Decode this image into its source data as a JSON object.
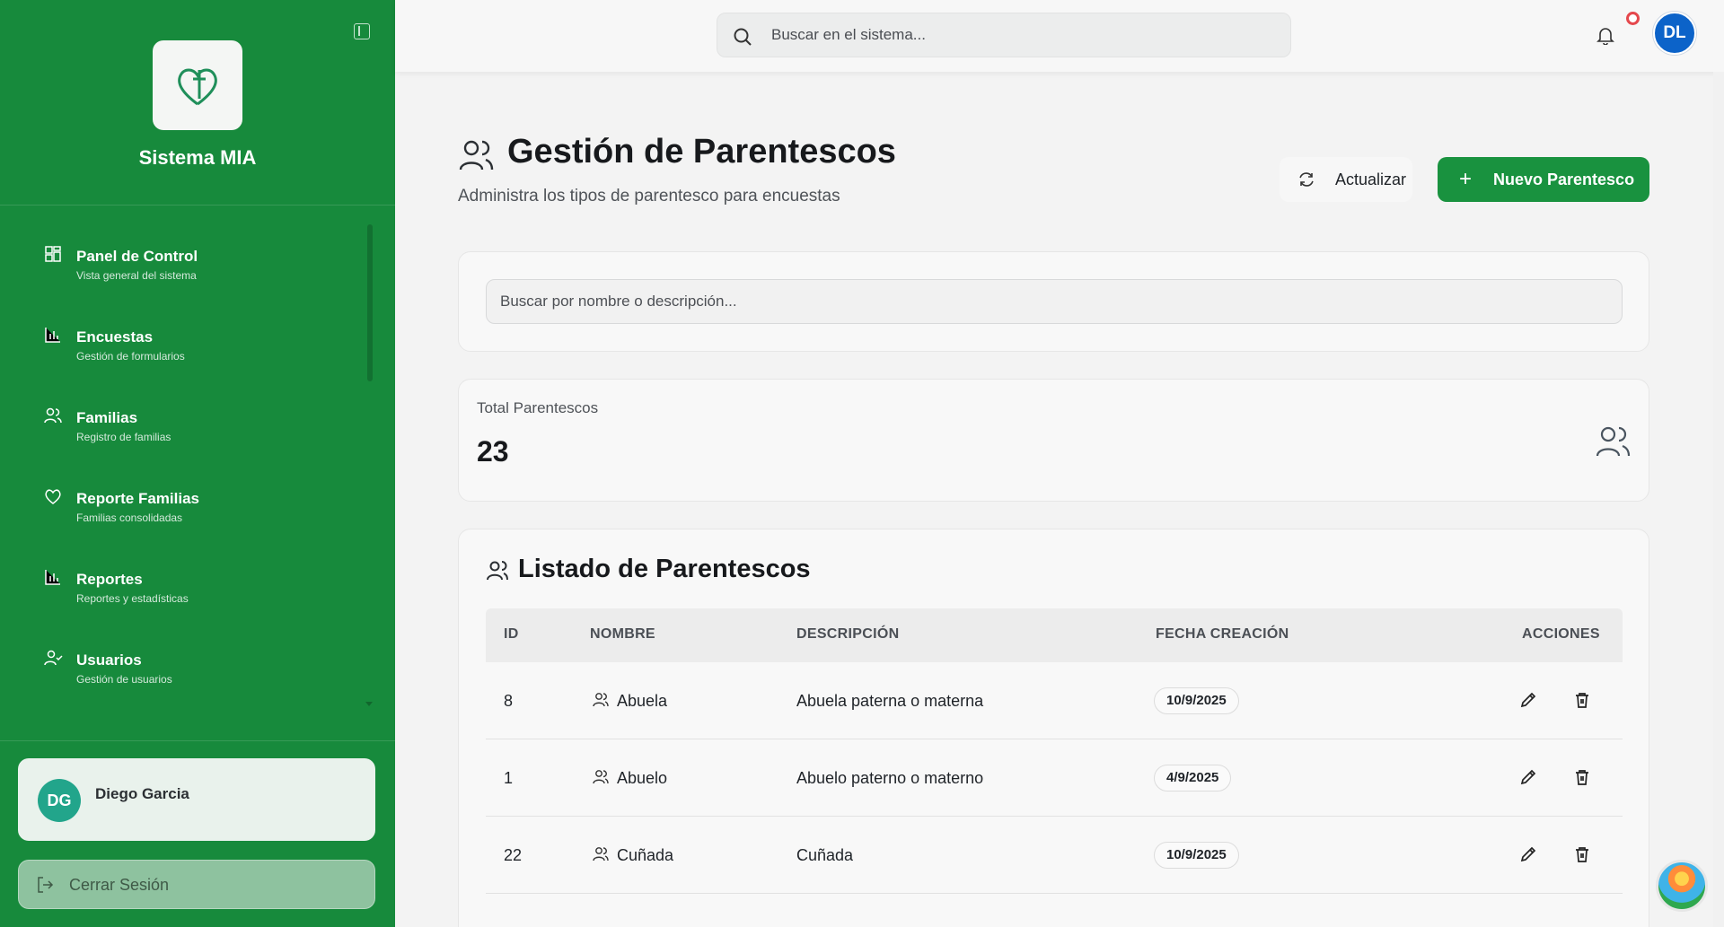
{
  "sidebar": {
    "brand": "Sistema MIA",
    "nav": [
      {
        "label": "Panel de Control",
        "sub": "Vista general del sistema",
        "icon": "dashboard-icon"
      },
      {
        "label": "Encuestas",
        "sub": "Gestión de formularios",
        "icon": "bar-chart-icon"
      },
      {
        "label": "Familias",
        "sub": "Registro de familias",
        "icon": "users-icon"
      },
      {
        "label": "Reporte Familias",
        "sub": "Familias consolidadas",
        "icon": "heart-icon"
      },
      {
        "label": "Reportes",
        "sub": "Reportes y estadísticas",
        "icon": "bar-chart-icon"
      },
      {
        "label": "Usuarios",
        "sub": "Gestión de usuarios",
        "icon": "user-check-icon"
      }
    ],
    "user": {
      "initials": "DG",
      "name": "Diego Garcia"
    },
    "logout_label": "Cerrar Sesión"
  },
  "topbar": {
    "search_placeholder": "Buscar en el sistema...",
    "avatar_initials": "DL"
  },
  "page": {
    "title": "Gestión de Parentescos",
    "subtitle": "Administra los tipos de parentesco para encuestas",
    "refresh_label": "Actualizar",
    "new_label": "Nuevo Parentesco",
    "filter_placeholder": "Buscar por nombre o descripción...",
    "stat_label": "Total Parentescos",
    "stat_value": "23",
    "list_title": "Listado de Parentescos"
  },
  "table": {
    "headers": [
      "ID",
      "NOMBRE",
      "DESCRIPCIÓN",
      "FECHA CREACIÓN",
      "ACCIONES"
    ],
    "rows": [
      {
        "id": "8",
        "name": "Abuela",
        "description": "Abuela paterna o materna",
        "date": "10/9/2025"
      },
      {
        "id": "1",
        "name": "Abuelo",
        "description": "Abuelo paterno o materno",
        "date": "4/9/2025"
      },
      {
        "id": "22",
        "name": "Cuñada",
        "description": "Cuñada",
        "date": "10/9/2025"
      }
    ]
  },
  "colors": {
    "sidebar": "#178a3c",
    "primary_button": "#19923f",
    "avatar": "#0c63c9",
    "notification": "#e5484d"
  }
}
